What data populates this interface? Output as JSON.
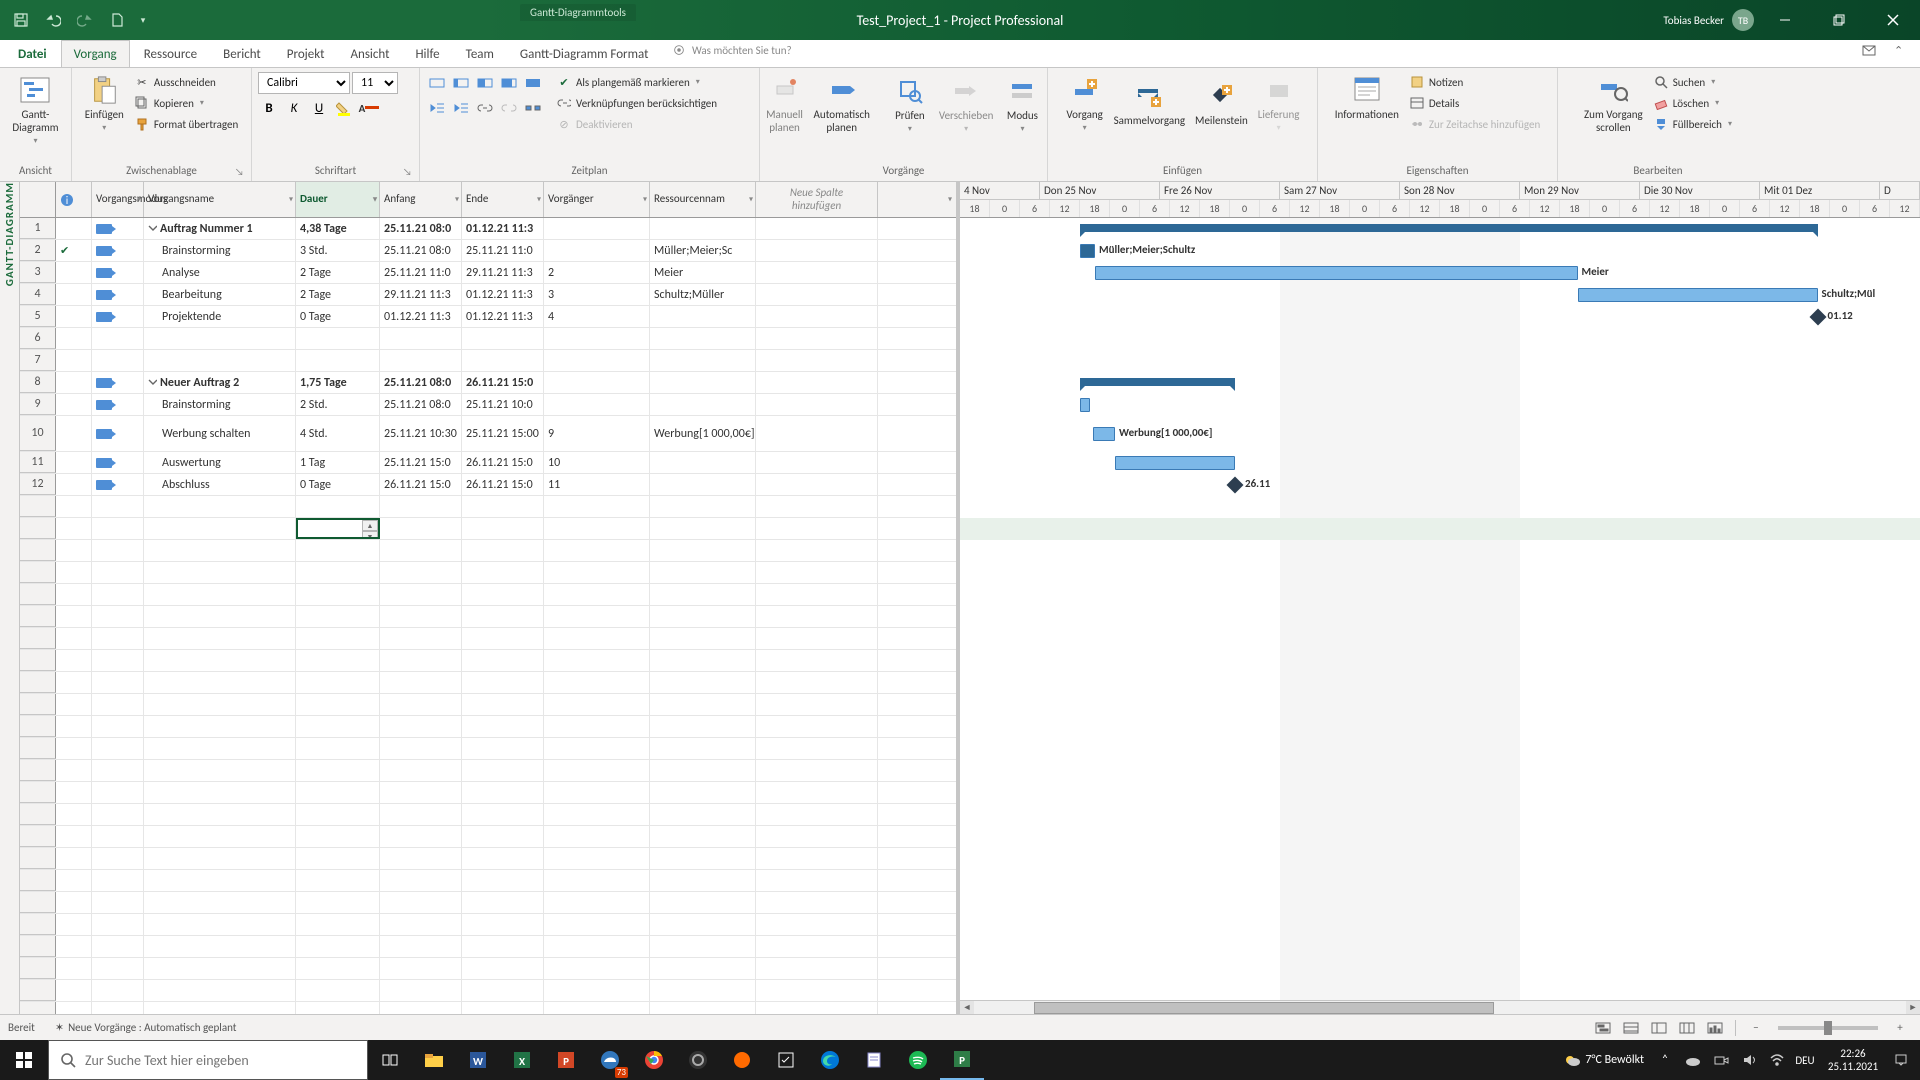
{
  "app": {
    "tools_tab": "Gantt-Diagrammtools",
    "title": "Test_Project_1  -  Project Professional",
    "user_name": "Tobias Becker",
    "user_initials": "TB"
  },
  "tabs": {
    "file": "Datei",
    "task": "Vorgang",
    "resource": "Ressource",
    "report": "Bericht",
    "project": "Projekt",
    "view": "Ansicht",
    "help": "Hilfe",
    "team": "Team",
    "format": "Gantt-Diagramm Format",
    "tellme": "Was möchten Sie tun?"
  },
  "ribbon": {
    "gantt_view": "Gantt-\nDiagramm",
    "group_view": "Ansicht",
    "paste": "Einfügen",
    "cut": "Ausschneiden",
    "copy_label": "Kopieren",
    "format_painter": "Format übertragen",
    "group_clipboard": "Zwischenablage",
    "font_name": "Calibri",
    "font_size": "11",
    "group_font": "Schriftart",
    "mark_ontrack": "Als plangemäß markieren",
    "respect_links": "Verknüpfungen berücksichtigen",
    "deactivate": "Deaktivieren",
    "group_schedule": "Zeitplan",
    "manual": "Manuell\nplanen",
    "auto": "Automatisch\nplanen",
    "inspect": "Prüfen",
    "move": "Verschieben",
    "mode": "Modus",
    "group_tasks": "Vorgänge",
    "task_btn": "Vorgang",
    "summary_btn": "Sammelvorgang",
    "milestone_btn": "Meilenstein",
    "delivery_btn": "Lieferung",
    "group_insert": "Einfügen",
    "information": "Informationen",
    "notes": "Notizen",
    "details": "Details",
    "add_timeline": "Zur Zeitachse hinzufügen",
    "group_props": "Eigenschaften",
    "scroll_task": "Zum Vorgang\nscrollen",
    "find": "Suchen",
    "clear_lbl": "Löschen",
    "fill": "Füllbereich",
    "group_edit": "Bearbeiten"
  },
  "vertical_label": "GANTT-DIAGRAMM",
  "columns": {
    "info": "",
    "mode": "Vorgangsmodus",
    "name": "Vorgangsname",
    "dur": "Dauer",
    "start": "Anfang",
    "end": "Ende",
    "pred": "Vorgänger",
    "res": "Ressourcennam",
    "newcol": "Neue Spalte\nhinzufügen"
  },
  "rows": [
    {
      "n": "1",
      "summary": true,
      "name": "Auftrag Nummer 1",
      "dur": "4,38 Tage",
      "start": "25.11.21 08:0",
      "end": "01.12.21 11:3",
      "pred": "",
      "res": ""
    },
    {
      "n": "2",
      "check": true,
      "name": "Brainstorming",
      "dur": "3 Std.",
      "start": "25.11.21 08:0",
      "end": "25.11.21 11:0",
      "pred": "",
      "res": "Müller;Meier;Sc"
    },
    {
      "n": "3",
      "name": "Analyse",
      "dur": "2 Tage",
      "start": "25.11.21 11:0",
      "end": "29.11.21 11:3",
      "pred": "2",
      "res": "Meier"
    },
    {
      "n": "4",
      "name": "Bearbeitung",
      "dur": "2 Tage",
      "start": "29.11.21 11:3",
      "end": "01.12.21 11:3",
      "pred": "3",
      "res": "Schultz;Müller"
    },
    {
      "n": "5",
      "name": "Projektende",
      "dur": "0 Tage",
      "start": "01.12.21 11:3",
      "end": "01.12.21 11:3",
      "pred": "4",
      "res": ""
    },
    {
      "n": "6"
    },
    {
      "n": "7"
    },
    {
      "n": "8",
      "summary": true,
      "name": "Neuer Auftrag 2",
      "dur": "1,75 Tage",
      "start": "25.11.21 08:0",
      "end": "26.11.21 15:0",
      "pred": "",
      "res": ""
    },
    {
      "n": "9",
      "name": "Brainstorming",
      "dur": "2 Std.",
      "start": "25.11.21 08:0",
      "end": "25.11.21 10:0",
      "pred": "",
      "res": ""
    },
    {
      "n": "10",
      "tall": true,
      "name": "Werbung schalten",
      "dur": "4 Std.",
      "start": "25.11.21 10:30",
      "end": "25.11.21 15:00",
      "pred": "9",
      "res": "Werbung[1 000,00€]"
    },
    {
      "n": "11",
      "name": "Auswertung",
      "dur": "1 Tag",
      "start": "25.11.21 15:0",
      "end": "26.11.21 15:0",
      "pred": "10",
      "res": ""
    },
    {
      "n": "12",
      "name": "Abschluss",
      "dur": "0 Tage",
      "start": "26.11.21 15:0",
      "end": "26.11.21 15:0",
      "pred": "11",
      "res": ""
    }
  ],
  "timeline": {
    "days": [
      "4 Nov",
      "Don 25 Nov",
      "Fre 26 Nov",
      "Sam 27 Nov",
      "Son 28 Nov",
      "Mon 29 Nov",
      "Die 30 Nov",
      "Mit 01 Dez",
      "D"
    ],
    "hours": [
      "18",
      "0",
      "6",
      "12",
      "18",
      "0",
      "6",
      "12",
      "18",
      "0",
      "6",
      "12",
      "18",
      "0",
      "6",
      "12",
      "18",
      "0",
      "6",
      "12",
      "18",
      "0",
      "6",
      "12",
      "18",
      "0",
      "6",
      "12",
      "18",
      "0",
      "6",
      "12",
      "18"
    ]
  },
  "gantt_labels": {
    "r2": "Müller;Meier;Schultz",
    "r3": "Meier",
    "r4": "Schultz;Mül",
    "r5": "01.12",
    "r10": "Werbung[1 000,00€]",
    "r12": "26.11"
  },
  "status": {
    "ready": "Bereit",
    "mode": "Neue Vorgänge : Automatisch geplant"
  },
  "taskbar": {
    "search_ph": "Zur Suche Text hier eingeben",
    "weather": "7°C  Bewölkt",
    "time": "22:26",
    "date": "25.11.2021",
    "edge_badge": "73"
  }
}
